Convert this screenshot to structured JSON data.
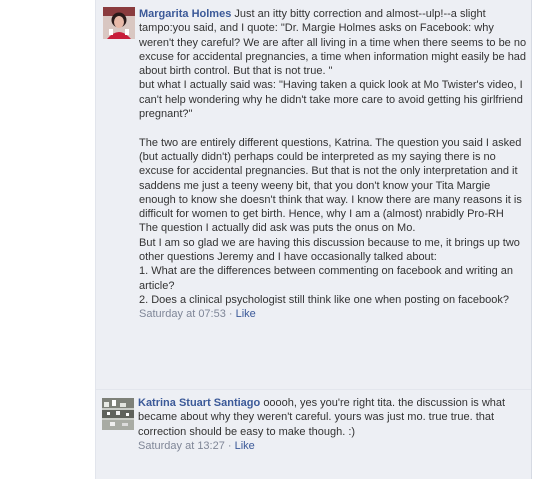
{
  "comments": [
    {
      "author": "Margarita Holmes",
      "text": "Just an itty bitty correction and almost--ulp!--a slight tampo:you said, and I quote: \"Dr. Margie Holmes asks on Facebook: why weren't they careful? We are after all living in a time when there seems to be no excuse for accidental pregnancies, a time when information might easily be had about birth control. But that is not true. \"\nbut what I actually said was: \"Having taken a quick look at Mo Twister's video, I can't help wondering why he didn't take more care to avoid getting his girlfriend pregnant?\"\n\nThe two are entirely different questions, Katrina. The question you said I asked (but actually didn't) perhaps could be interpreted as my saying there is no excuse for accidental pregnancies. But that is not the only interpretation and it saddens me just a teeny weeny bit, that you don't know your Tita Margie enough to know she doesn't think that way. I know there are many reasons it is difficult for women to get birth. Hence, why I am a (almost) nrabidly Pro-RH\nThe question I actually did ask was puts the onus on Mo.\nBut I am so glad we are having this discussion because to me, it brings up two other questions Jeremy and I have occasionally talked about:\n1. What are the differences between commenting on facebook and writing an article?\n2. Does a clinical psychologist still think like one when posting on facebook?",
      "timestamp": "Saturday at 07:53",
      "separator": " · ",
      "like_label": "Like"
    },
    {
      "author": "Katrina Stuart Santiago",
      "text": "ooooh, yes you're right tita. the discussion is what became about why they weren't careful. yours was just mo. true true. that correction should be easy to make though. :)",
      "timestamp": "Saturday at 13:27",
      "separator": " · ",
      "like_label": "Like"
    }
  ],
  "colors": {
    "panel_bg": "#edeff4",
    "link": "#3b5998",
    "text": "#333333",
    "meta": "#7f8697"
  },
  "icons": [
    "avatar-margarita-holmes",
    "avatar-katrina-stuart-santiago"
  ]
}
